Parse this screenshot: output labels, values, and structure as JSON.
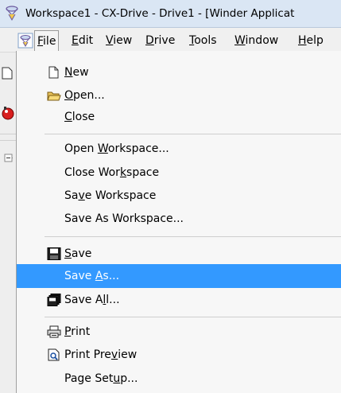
{
  "window": {
    "title": "Workspace1 - CX-Drive - Drive1 - [Winder Applicat"
  },
  "menubar": [
    {
      "id": "file",
      "label_pre": "",
      "label_ul": "F",
      "label_post": "ile"
    },
    {
      "id": "edit",
      "label_pre": "",
      "label_ul": "E",
      "label_post": "dit"
    },
    {
      "id": "view",
      "label_pre": "",
      "label_ul": "V",
      "label_post": "iew"
    },
    {
      "id": "drive",
      "label_pre": "",
      "label_ul": "D",
      "label_post": "rive"
    },
    {
      "id": "tools",
      "label_pre": "",
      "label_ul": "T",
      "label_post": "ools"
    },
    {
      "id": "window",
      "label_pre": "",
      "label_ul": "W",
      "label_post": "indow"
    },
    {
      "id": "help",
      "label_pre": "",
      "label_ul": "H",
      "label_post": "elp"
    }
  ],
  "file_menu": {
    "new": {
      "pre": "",
      "ul": "N",
      "post": "ew"
    },
    "open": {
      "pre": "",
      "ul": "O",
      "post": "pen..."
    },
    "close": {
      "pre": "",
      "ul": "C",
      "post": "lose"
    },
    "open_workspace": {
      "pre": "Open ",
      "ul": "W",
      "post": "orkspace..."
    },
    "close_workspace": {
      "pre": "Close Wor",
      "ul": "k",
      "post": "space"
    },
    "save_workspace": {
      "pre": "Sa",
      "ul": "v",
      "post": "e Workspace"
    },
    "save_as_workspace": {
      "pre": "Save As Workspace...",
      "ul": "",
      "post": ""
    },
    "save": {
      "pre": "",
      "ul": "S",
      "post": "ave"
    },
    "save_as": {
      "pre": "Save ",
      "ul": "A",
      "post": "s..."
    },
    "save_all": {
      "pre": "Save A",
      "ul": "l",
      "post": "l..."
    },
    "print": {
      "pre": "",
      "ul": "P",
      "post": "rint"
    },
    "print_preview": {
      "pre": "Print Pre",
      "ul": "v",
      "post": "iew"
    },
    "page_setup": {
      "pre": "Page Set",
      "ul": "u",
      "post": "p..."
    },
    "highlighted_item": "save_as"
  },
  "colors": {
    "highlight": "#3399ff",
    "titlebar": "#dae6f4",
    "menu_bg": "#f7f7f7"
  }
}
